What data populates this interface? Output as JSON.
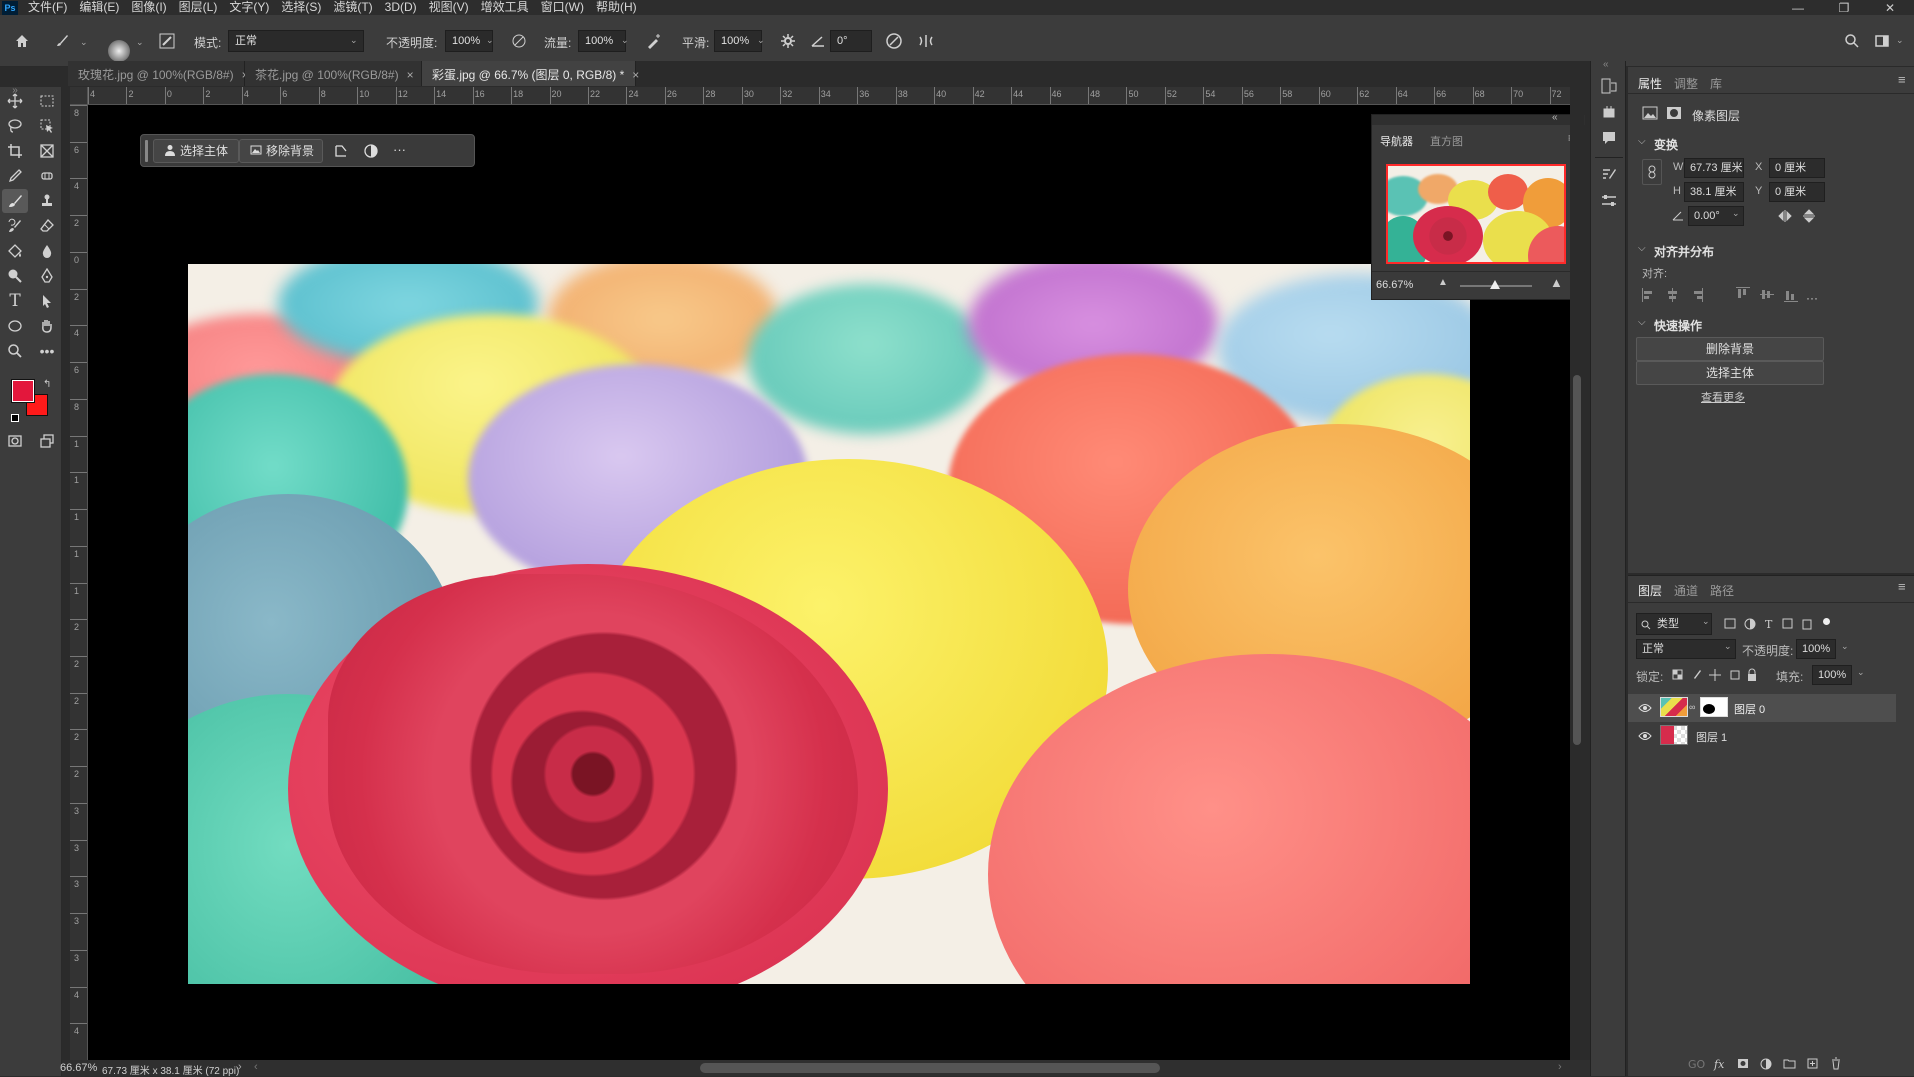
{
  "menubar": {
    "logo": "Ps",
    "items": [
      "文件(F)",
      "编辑(E)",
      "图像(I)",
      "图层(L)",
      "文字(Y)",
      "选择(S)",
      "滤镜(T)",
      "3D(D)",
      "视图(V)",
      "增效工具",
      "窗口(W)",
      "帮助(H)"
    ],
    "controls": {
      "minimize": "—",
      "restore": "❐",
      "close": "✕"
    }
  },
  "options": {
    "brush_size": "100",
    "mode_label": "模式:",
    "mode_value": "正常",
    "opacity_label": "不透明度:",
    "opacity_value": "100%",
    "flow_label": "流量:",
    "flow_value": "100%",
    "smooth_label": "平滑:",
    "smooth_value": "100%",
    "angle_value": "0°"
  },
  "tabs": [
    {
      "label": "玫瑰花.jpg @ 100%(RGB/8#)",
      "active": false
    },
    {
      "label": "茶花.jpg @ 100%(RGB/8#)",
      "active": false
    },
    {
      "label": "彩蛋.jpg @ 66.7% (图层 0, RGB/8) *",
      "active": true
    }
  ],
  "ruler": {
    "h_ticks": [
      "4",
      "2",
      "0",
      "2",
      "4",
      "6",
      "8",
      "10",
      "12",
      "14",
      "16",
      "18",
      "20",
      "22",
      "24",
      "26",
      "28",
      "30",
      "32",
      "34",
      "36",
      "38",
      "40",
      "42",
      "44",
      "46",
      "48",
      "50",
      "52",
      "54",
      "56",
      "58",
      "60",
      "62",
      "64",
      "66",
      "68",
      "70",
      "72"
    ],
    "v_ticks": [
      "8",
      "6",
      "4",
      "2",
      "0",
      "2",
      "4",
      "6",
      "8",
      "1",
      "1",
      "1",
      "1",
      "1",
      "2",
      "2",
      "2",
      "2",
      "2",
      "3",
      "3",
      "3",
      "3",
      "3",
      "4",
      "4"
    ]
  },
  "context_bar": {
    "select_subject": "选择主体",
    "remove_bg": "移除背景",
    "more": "···"
  },
  "navigator": {
    "tab_nav": "导航器",
    "tab_hist": "直方图",
    "zoom": "66.67%"
  },
  "properties": {
    "tabs": [
      "属性",
      "调整",
      "库"
    ],
    "layer_type": "像素图层",
    "transform_title": "变换",
    "w_label": "W",
    "w_value": "67.73 厘米",
    "h_label": "H",
    "h_value": "38.1 厘米",
    "x_label": "X",
    "x_value": "0 厘米",
    "y_label": "Y",
    "y_value": "0 厘米",
    "angle_value": "0.00°",
    "align_title": "对齐并分布",
    "align_label": "对齐:",
    "align_more": "···",
    "quick_title": "快速操作",
    "quick_remove_bg": "删除背景",
    "quick_select_subject": "选择主体",
    "quick_more": "查看更多"
  },
  "layers": {
    "tabs": [
      "图层",
      "通道",
      "路径"
    ],
    "filter_value": "类型",
    "blend_mode": "正常",
    "opacity_label": "不透明度:",
    "opacity_value": "100%",
    "lock_label": "锁定:",
    "fill_label": "填充:",
    "fill_value": "100%",
    "items": [
      {
        "name": "图层 0",
        "selected": true
      },
      {
        "name": "图层 1",
        "selected": false
      }
    ]
  },
  "status": {
    "zoom": "66.67%",
    "doc_info": "67.73 厘米 x 38.1 厘米 (72 ppi)"
  },
  "colors": {
    "foreground": "#e3173c",
    "background": "#ff1a1a",
    "accent": "#31a8ff"
  }
}
